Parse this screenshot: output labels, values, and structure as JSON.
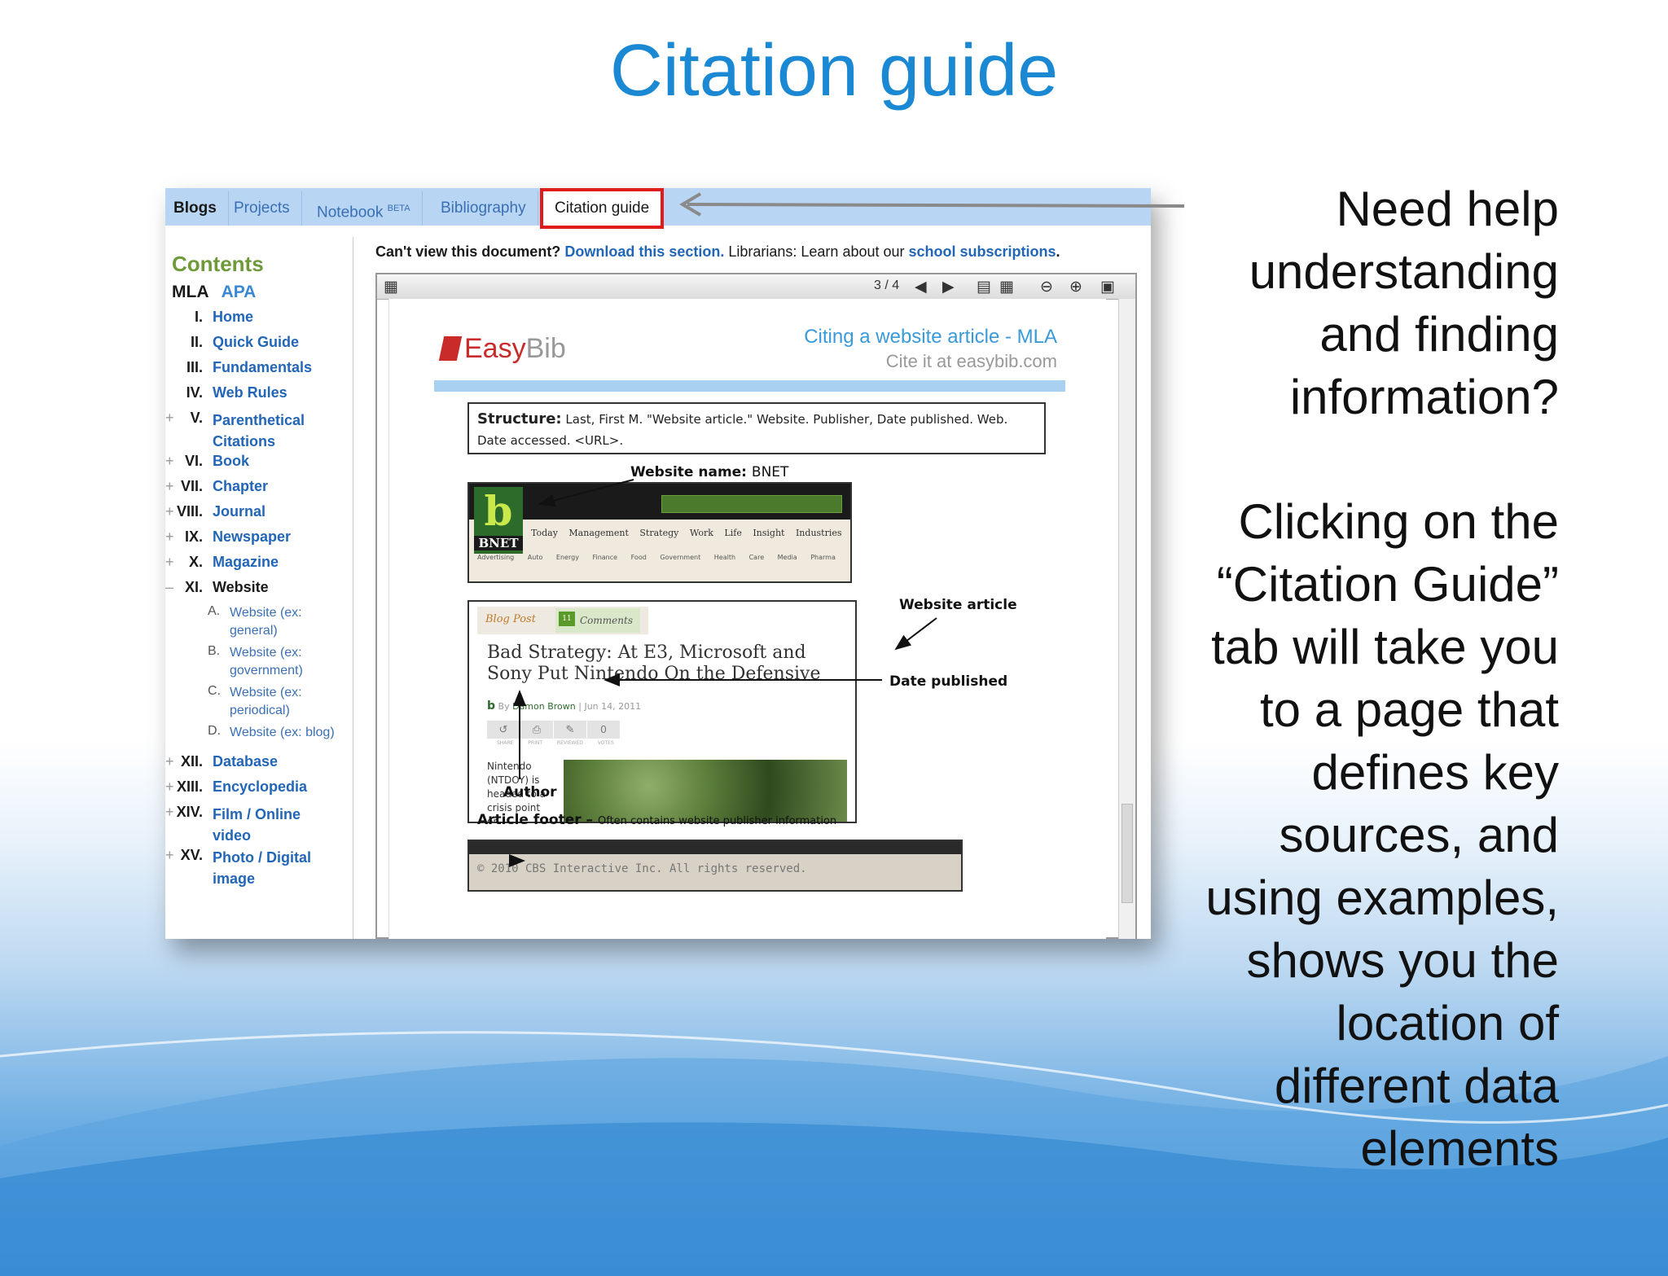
{
  "slide": {
    "title": "Citation guide",
    "help_lines": [
      "Need help",
      "understanding",
      "and finding",
      "information?"
    ],
    "explain_lines": [
      "Clicking on the",
      "“Citation Guide”",
      "tab will take you",
      "to a page that",
      "defines key",
      "sources, and",
      "using examples,",
      "shows you the",
      "location of",
      "different data",
      "elements"
    ]
  },
  "tabs": {
    "blogs": "Blogs",
    "projects": "Projects",
    "notebook": "Notebook",
    "notebook_badge": "BETA",
    "bibliography": "Bibliography",
    "citation_guide": "Citation guide"
  },
  "sidebar": {
    "title": "Contents",
    "style_mla": "MLA",
    "style_apa": "APA",
    "items": [
      {
        "num": "I.",
        "label": "Home"
      },
      {
        "num": "II.",
        "label": "Quick Guide"
      },
      {
        "num": "III.",
        "label": "Fundamentals"
      },
      {
        "num": "IV.",
        "label": "Web Rules"
      },
      {
        "num": "V.",
        "label": "Parenthetical Citations"
      },
      {
        "num": "VI.",
        "label": "Book"
      },
      {
        "num": "VII.",
        "label": "Chapter"
      },
      {
        "num": "VIII.",
        "label": "Journal"
      },
      {
        "num": "IX.",
        "label": "Newspaper"
      },
      {
        "num": "X.",
        "label": "Magazine"
      },
      {
        "num": "XI.",
        "label": "Website"
      },
      {
        "num": "XII.",
        "label": "Database"
      },
      {
        "num": "XIII.",
        "label": "Encyclopedia"
      },
      {
        "num": "XIV.",
        "label": "Film / Online video"
      },
      {
        "num": "XV.",
        "label": "Photo / Digital image"
      }
    ],
    "website_subitems": [
      {
        "letter": "A.",
        "label": "Website (ex: general)"
      },
      {
        "letter": "B.",
        "label": "Website (ex: government)"
      },
      {
        "letter": "C.",
        "label": "Website (ex: periodical)"
      },
      {
        "letter": "D.",
        "label": "Website (ex: blog)"
      }
    ]
  },
  "doc_header": {
    "prefix": "Can't view this document?",
    "download_link": "Download this section.",
    "librarians": "Librarians: Learn about our",
    "subscriptions_link": "school subscriptions",
    "suffix": "."
  },
  "viewer": {
    "page_indicator": "3 / 4"
  },
  "page": {
    "logo_easy": "Easy",
    "logo_bib": "Bib",
    "citing_title": "Citing a website article - MLA",
    "citing_subtitle": "Cite it at easybib.com",
    "structure_label": "Structure:",
    "structure_text": "Last, First M. \"Website article.\" Website. Publisher, Date published. Web. Date accessed. <URL>.",
    "website_name_label": "Website name:",
    "website_name_value": "BNET",
    "bnet_logo": "b",
    "bnet_logo_small": "BNET",
    "bnet_nav": "Today Management Strategy Work Life Insight Industries Busin",
    "bnet_subnav": "Advertising Auto Energy Finance Food Government Health Care Media Pharma",
    "website_article_label": "Website article",
    "date_published_label": "Date published",
    "author_label": "Author",
    "article_footer_label": "Article footer –",
    "article_footer_note": "Often contains website publisher information",
    "blog_post_tab": "Blog Post",
    "comments_tab": "Comments",
    "comments_count": "11",
    "headline": "Bad Strategy: At E3, Microsoft and Sony Put Nintendo On the Defensive",
    "byline_by": "By",
    "byline_author": "Damon Brown",
    "byline_date": "| Jun 14, 2011",
    "share_votes": "0",
    "share_labels": "SHARE PRINT REVIEWED VOTES",
    "article_snippet": "Nintendo (NTDOY) is headed to a crisis point or",
    "footer_text": "© 2010 CBS Interactive Inc. All rights reserved."
  },
  "colors": {
    "title_blue": "#1b88d4",
    "link_blue": "#2266b8",
    "highlight_red": "#e01b1b",
    "contents_green": "#6f9a3a"
  }
}
